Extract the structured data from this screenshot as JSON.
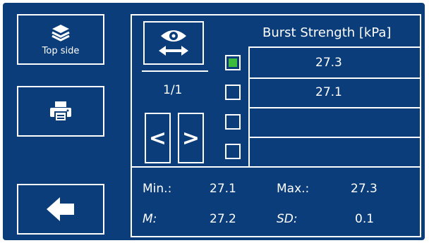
{
  "sidebar": {
    "side_label": "Top side",
    "side_icon": "layers-icon",
    "print_icon": "printer-icon",
    "back_icon": "arrow-left-icon"
  },
  "table": {
    "header": "Burst Strength [kPa]",
    "rows": [
      {
        "value": "27.3",
        "checked": true
      },
      {
        "value": "27.1",
        "checked": false
      },
      {
        "value": "",
        "checked": false
      },
      {
        "value": "",
        "checked": false
      }
    ]
  },
  "pager": {
    "page": "1/1",
    "prev_label": "<",
    "next_label": ">",
    "view_icon": "eye-horizontal-arrow-icon"
  },
  "stats": {
    "min_label": "Min.:",
    "min_value": "27.1",
    "max_label": "Max.:",
    "max_value": "27.3",
    "mean_label": "M:",
    "mean_value": "27.2",
    "sd_label": "SD:",
    "sd_value": "0.1"
  },
  "colors": {
    "background": "#0a3d7a",
    "checked": "#3dbb3d",
    "foreground": "#ffffff"
  }
}
